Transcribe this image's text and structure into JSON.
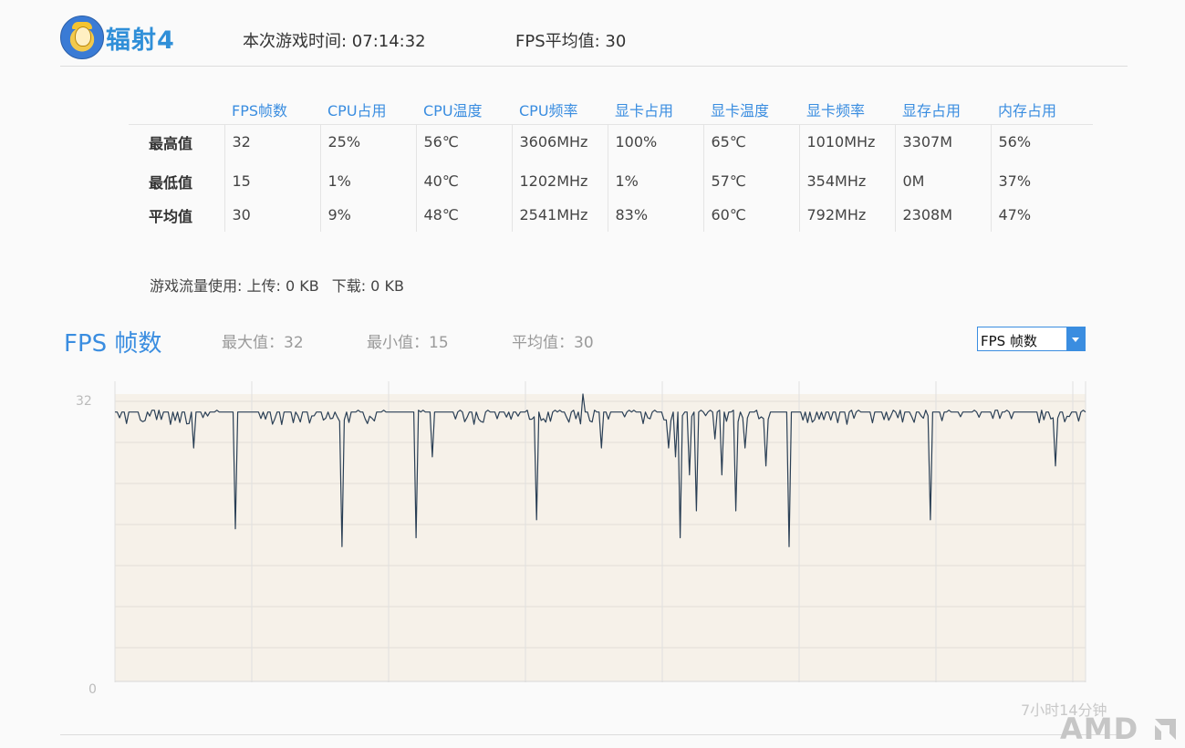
{
  "header": {
    "game_title": "辐射4",
    "session_time": "本次游戏时间: 07:14:32",
    "fps_average": "FPS平均值: 30"
  },
  "stats_table": {
    "columns": [
      "FPS帧数",
      "CPU占用",
      "CPU温度",
      "CPU频率",
      "显卡占用",
      "显卡温度",
      "显卡频率",
      "显存占用",
      "内存占用"
    ],
    "rows": [
      {
        "label": "最高值",
        "values": [
          "32",
          "25%",
          "56℃",
          "3606MHz",
          "100%",
          "65℃",
          "1010MHz",
          "3307M",
          "56%"
        ]
      },
      {
        "label": "最低值",
        "values": [
          "15",
          "1%",
          "40℃",
          "1202MHz",
          "1%",
          "57℃",
          "354MHz",
          "0M",
          "37%"
        ]
      },
      {
        "label": "平均值",
        "values": [
          "30",
          "9%",
          "48℃",
          "2541MHz",
          "83%",
          "60℃",
          "792MHz",
          "2308M",
          "47%"
        ]
      }
    ]
  },
  "traffic": {
    "label": "游戏流量使用: ",
    "upload": "上传: 0 KB",
    "download": "下载: 0 KB"
  },
  "chart_section": {
    "title": "FPS 帧数",
    "max_label": "最大值：32",
    "min_label": "最小值：15",
    "avg_label": "平均值：30",
    "dropdown_selected": "FPS 帧数",
    "accent_color": "#3a8de0"
  },
  "chart_data": {
    "type": "line",
    "ylim": [
      0,
      32
    ],
    "yticks": [
      "32",
      "0"
    ],
    "x_end_label": "7小时14分钟",
    "line_color": "#2a3f55",
    "fill_color": "#f6f1e9",
    "baseline": 30,
    "dips": [
      {
        "pos": 0.081,
        "value": 26
      },
      {
        "pos": 0.124,
        "value": 17
      },
      {
        "pos": 0.235,
        "value": 15
      },
      {
        "pos": 0.31,
        "value": 16
      },
      {
        "pos": 0.326,
        "value": 25
      },
      {
        "pos": 0.435,
        "value": 18
      },
      {
        "pos": 0.502,
        "value": 26
      },
      {
        "pos": 0.57,
        "value": 26
      },
      {
        "pos": 0.577,
        "value": 25
      },
      {
        "pos": 0.582,
        "value": 16
      },
      {
        "pos": 0.592,
        "value": 23
      },
      {
        "pos": 0.6,
        "value": 19
      },
      {
        "pos": 0.617,
        "value": 27
      },
      {
        "pos": 0.626,
        "value": 23
      },
      {
        "pos": 0.64,
        "value": 19
      },
      {
        "pos": 0.649,
        "value": 26
      },
      {
        "pos": 0.67,
        "value": 24
      },
      {
        "pos": 0.695,
        "value": 15
      },
      {
        "pos": 0.839,
        "value": 18
      },
      {
        "pos": 0.969,
        "value": 24
      }
    ]
  },
  "branding": {
    "amd": "AMD"
  }
}
